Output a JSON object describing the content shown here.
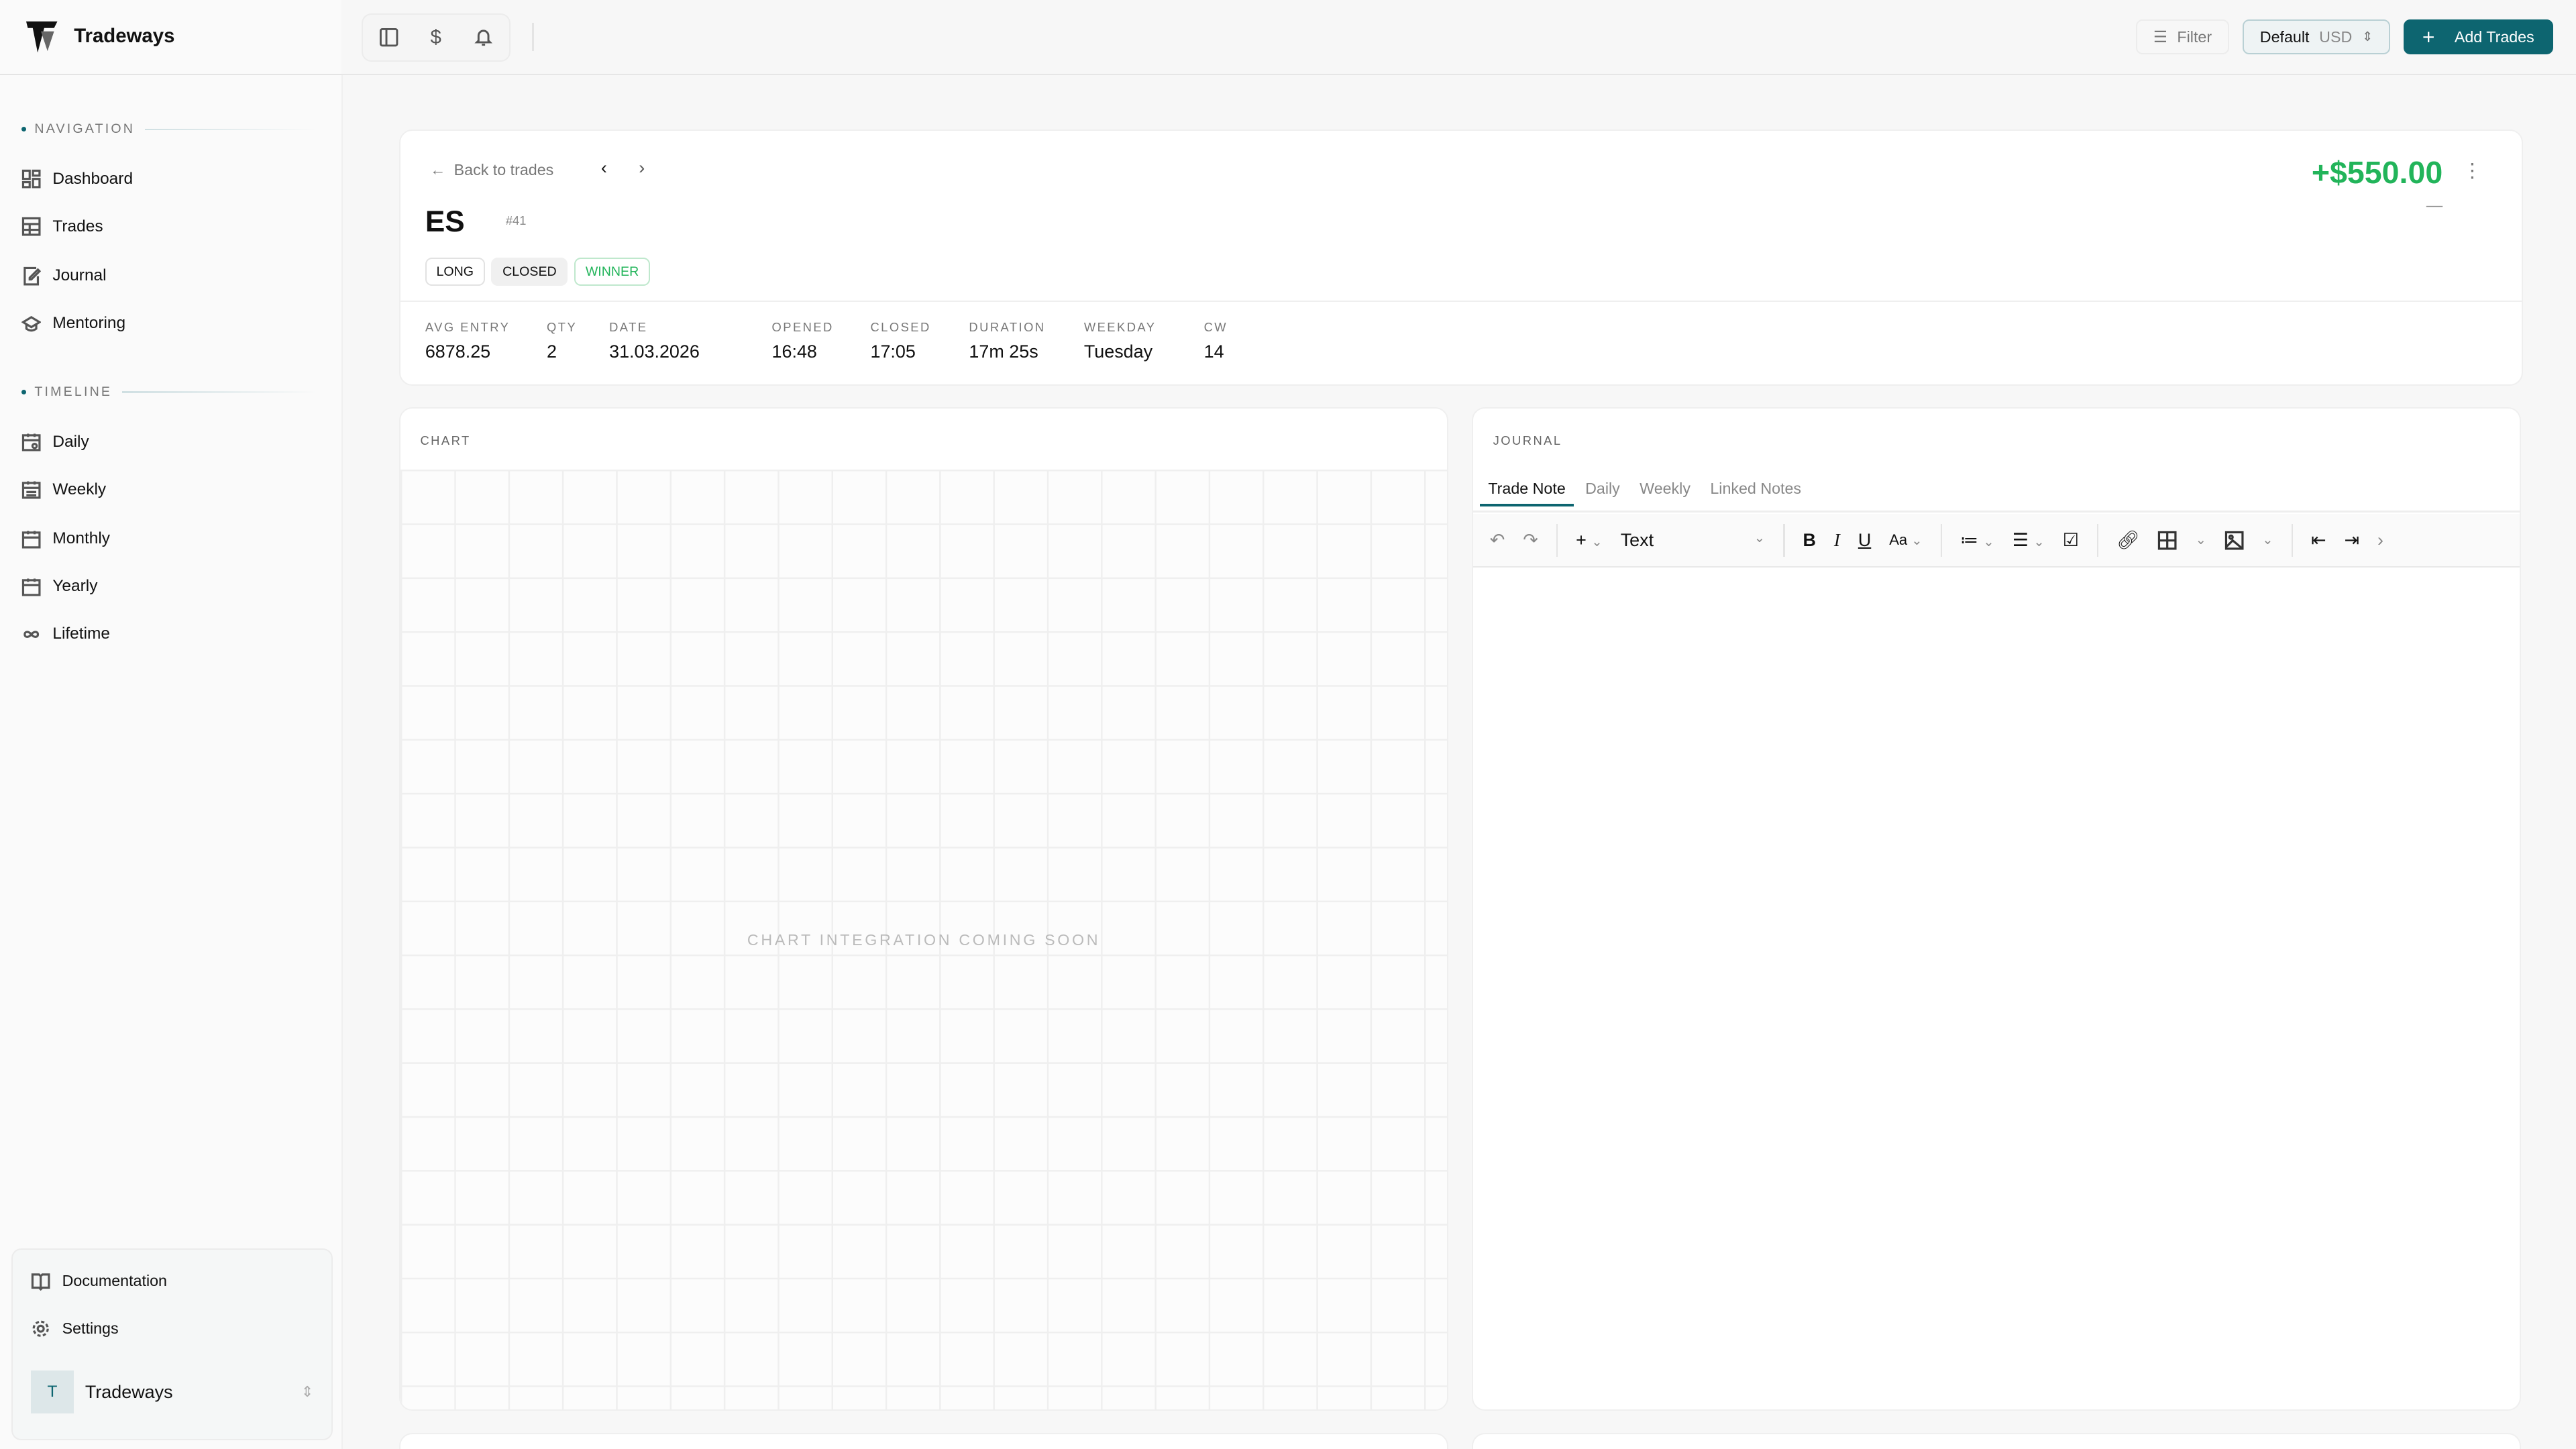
{
  "app": {
    "name": "Tradeways"
  },
  "sidebar": {
    "nav_title": "NAVIGATION",
    "nav": [
      {
        "label": "Dashboard",
        "icon": "dashboard-icon"
      },
      {
        "label": "Trades",
        "icon": "table-icon"
      },
      {
        "label": "Journal",
        "icon": "journal-icon"
      },
      {
        "label": "Mentoring",
        "icon": "graduation-cap-icon"
      }
    ],
    "timeline_title": "TIMELINE",
    "timeline": [
      {
        "label": "Daily",
        "icon": "calendar-day-icon"
      },
      {
        "label": "Weekly",
        "icon": "calendar-week-icon"
      },
      {
        "label": "Monthly",
        "icon": "calendar-icon"
      },
      {
        "label": "Yearly",
        "icon": "calendar-icon"
      },
      {
        "label": "Lifetime",
        "icon": "infinity-icon"
      }
    ],
    "documentation": "Documentation",
    "settings": "Settings",
    "workspace": {
      "initial": "T",
      "name": "Tradeways"
    }
  },
  "topbar": {
    "filter": "Filter",
    "account": "Default",
    "currency": "USD",
    "add_trades": "Add Trades"
  },
  "trade": {
    "back": "Back to trades",
    "symbol": "ES",
    "number": "#41",
    "badges": [
      "LONG",
      "CLOSED",
      "WINNER"
    ],
    "pnl": "+$550.00",
    "pnl_sub": "—",
    "stats": [
      {
        "label": "AVG ENTRY",
        "value": "6878.25"
      },
      {
        "label": "QTY",
        "value": "2"
      },
      {
        "label": "DATE",
        "value": "31.03.2026"
      },
      {
        "label": "OPENED",
        "value": "16:48"
      },
      {
        "label": "CLOSED",
        "value": "17:05"
      },
      {
        "label": "DURATION",
        "value": "17m 25s"
      },
      {
        "label": "WEEKDAY",
        "value": "Tuesday"
      },
      {
        "label": "CW",
        "value": "14"
      }
    ]
  },
  "chart": {
    "title": "CHART",
    "placeholder": "CHART INTEGRATION COMING SOON"
  },
  "journal": {
    "title": "JOURNAL",
    "tabs": [
      "Trade Note",
      "Daily",
      "Weekly",
      "Linked Notes"
    ],
    "active_tab": "Trade Note",
    "block_type": "Text",
    "font_size_label": "Aa"
  },
  "colors": {
    "accent": "#0d6570",
    "profit": "#22b45a"
  }
}
